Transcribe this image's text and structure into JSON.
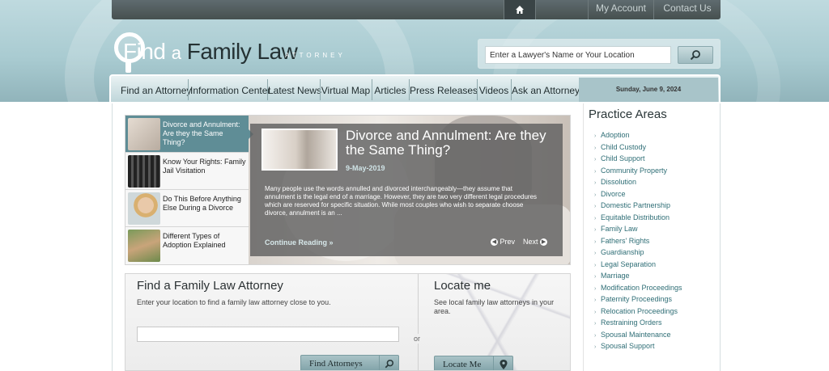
{
  "topbar": {
    "links": [
      "My Account",
      "Contact Us"
    ],
    "home_icon": "home-icon"
  },
  "logo": {
    "find": "Find",
    "a": "a",
    "family_law": "Family Law",
    "sub": "ATTORNEY"
  },
  "search": {
    "placeholder": "Enter a Lawyer's Name or Your Location",
    "button_icon": "search-icon"
  },
  "nav": {
    "items": [
      "Find an Attorney",
      "Information Center",
      "Latest News",
      "Virtual Map",
      "Articles",
      "Press Releases",
      "Videos",
      "Ask an Attorney"
    ],
    "date": "Sunday, June 9, 2024"
  },
  "slider": {
    "thumbs": [
      {
        "title": "Divorce and Annulment: Are they the Same Thing?"
      },
      {
        "title": "Know Your Rights: Family Jail Visitation"
      },
      {
        "title": "Do This Before Anything Else During a Divorce"
      },
      {
        "title": "Different Types of Adoption Explained"
      }
    ],
    "active_title": "Divorce and Annulment: Are they the Same Thing?",
    "active_date": "9-May-2019",
    "active_body": "Many people use the words annulled and divorced interchangeably—they assume that annulment is the legal end of a marriage. However, they are two very different legal procedures which are reserved for specific situation. While most couples who wish to separate choose divorce, annulment is an ...",
    "continue": "Continue Reading",
    "prev": "Prev",
    "next": "Next"
  },
  "locate": {
    "find_title": "Find a Family Law Attorney",
    "find_text": "Enter your location to find a family law attorney close to you.",
    "find_button": "Find Attorneys",
    "or": "or",
    "locate_title": "Locate me",
    "locate_text": "See local family law attorneys in your area.",
    "locate_button": "Locate Me"
  },
  "practice": {
    "title": "Practice Areas",
    "items": [
      "Adoption",
      "Child Custody",
      "Child Support",
      "Community Property",
      "Dissolution",
      "Divorce",
      "Domestic Partnership",
      "Equitable Distribution",
      "Family Law",
      "Fathers' Rights",
      "Guardianship",
      "Legal Separation",
      "Marriage",
      "Modification Proceedings",
      "Paternity Proceedings",
      "Relocation Proceedings",
      "Restraining Orders",
      "Spousal Maintenance",
      "Spousal Support"
    ]
  }
}
